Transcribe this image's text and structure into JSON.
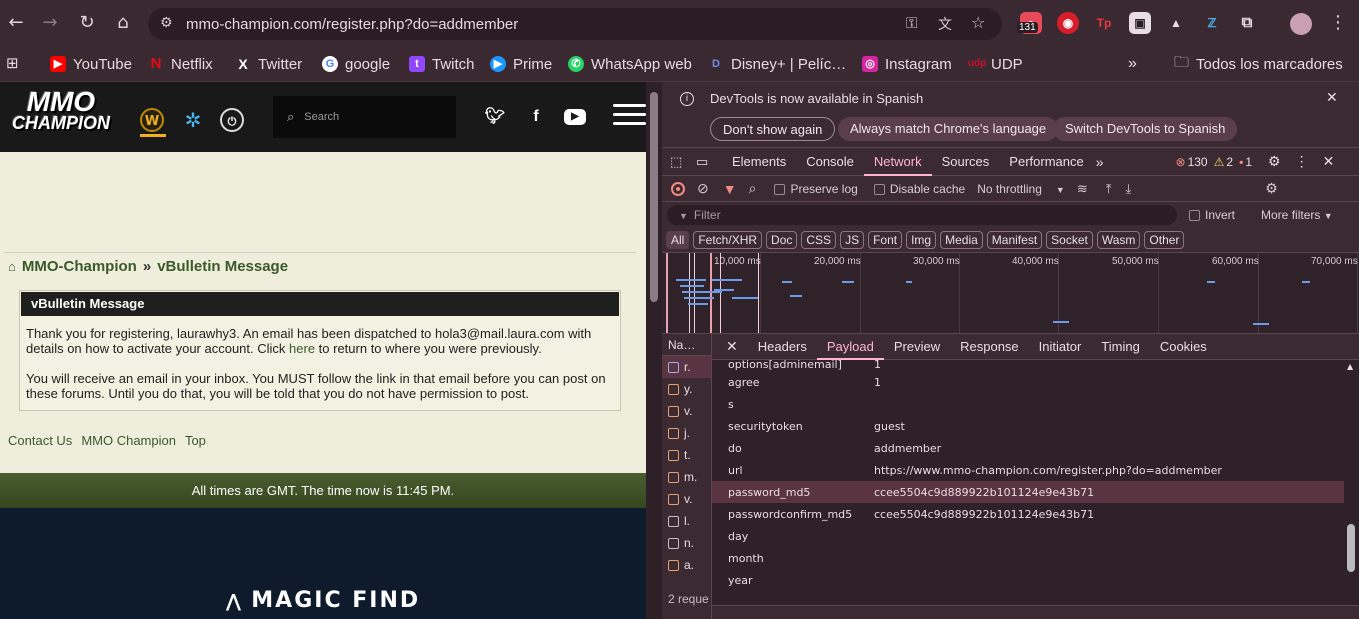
{
  "browser": {
    "url": "mmo-champion.com/register.php?do=addmember",
    "extensions": {
      "badge_count": "131"
    },
    "bookmarks": [
      {
        "label": "YouTube",
        "color": "#ff0000",
        "glyph": "▶"
      },
      {
        "label": "Netflix",
        "color": "#e50914",
        "glyph": "N"
      },
      {
        "label": "Twitter",
        "color": "#000000",
        "glyph": "X"
      },
      {
        "label": "google",
        "color": "#4285f4",
        "glyph": "G"
      },
      {
        "label": "Twitch",
        "color": "#9146ff",
        "glyph": "t"
      },
      {
        "label": "Prime",
        "color": "#1a98ff",
        "glyph": "▶"
      },
      {
        "label": "WhatsApp web",
        "color": "#25d366",
        "glyph": "✆"
      },
      {
        "label": "Disney+ | Pelíc…",
        "color": "#113ccf",
        "glyph": "D"
      },
      {
        "label": "Instagram",
        "color": "#d6249f",
        "glyph": "◎"
      },
      {
        "label": "UDP",
        "color": "#c8102e",
        "glyph": "u"
      }
    ],
    "all_bookmarks": "Todos los marcadores"
  },
  "site": {
    "logo_line1": "MMO",
    "logo_line2": "CHAMPION",
    "search_placeholder": "Search",
    "breadcrumb": {
      "home": "MMO-Champion",
      "sep": "»",
      "current": "vBulletin Message"
    },
    "message": {
      "title": "vBulletin Message",
      "p1_before": "Thank you for registering, laurawhy3. An email has been dispatched to hola3@mail.laura.com with details on how to activate your account. Click ",
      "p1_link": "here",
      "p1_after": " to return to where you were previously.",
      "p2": "You will receive an email in your inbox. You MUST follow the link in that email before you can post on these forums. Until you do that, you will be told that you do not have permission to post."
    },
    "footer_links": [
      "Contact Us",
      "MMO Champion",
      "Top"
    ],
    "time_text": "All times are GMT. The time now is 11:45 PM.",
    "ad_brand": "MAGIC FIND"
  },
  "devtools": {
    "infobar": {
      "text": "DevTools is now available in Spanish",
      "btn_dont_show": "Don't show again",
      "btn_match": "Always match Chrome's language",
      "btn_switch": "Switch DevTools to Spanish"
    },
    "tabs": [
      "Elements",
      "Console",
      "Network",
      "Sources",
      "Performance"
    ],
    "active_tab": "Network",
    "counts": {
      "errors": "130",
      "warnings": "2",
      "issues": "1"
    },
    "toolbar": {
      "preserve_log": "Preserve log",
      "disable_cache": "Disable cache",
      "throttling": "No throttling"
    },
    "filter": {
      "placeholder": "Filter",
      "invert": "Invert",
      "more_filters": "More filters"
    },
    "types": [
      "All",
      "Fetch/XHR",
      "Doc",
      "CSS",
      "JS",
      "Font",
      "Img",
      "Media",
      "Manifest",
      "Socket",
      "Wasm",
      "Other"
    ],
    "timeline_ticks": [
      "10,000 ms",
      "20,000 ms",
      "30,000 ms",
      "40,000 ms",
      "50,000 ms",
      "60,000 ms",
      "70,000 ms"
    ],
    "request_list": {
      "header": "Na…",
      "rows": [
        "r.",
        "y.",
        "v.",
        "j.",
        "t.",
        "m.",
        "v.",
        "l.",
        "n.",
        "a."
      ],
      "footer": "2 reque"
    },
    "detail_tabs": [
      "Headers",
      "Payload",
      "Preview",
      "Response",
      "Initiator",
      "Timing",
      "Cookies"
    ],
    "active_detail_tab": "Payload",
    "payload": [
      {
        "key": "options[adminemail]",
        "value": "1"
      },
      {
        "key": "agree",
        "value": "1"
      },
      {
        "key": "s",
        "value": ""
      },
      {
        "key": "securitytoken",
        "value": "guest"
      },
      {
        "key": "do",
        "value": "addmember"
      },
      {
        "key": "url",
        "value": "https://www.mmo-champion.com/register.php?do=addmember"
      },
      {
        "key": "password_md5",
        "value": "ccee5504c9d889922b101124e9e43b71"
      },
      {
        "key": "passwordconfirm_md5",
        "value": "ccee5504c9d889922b101124e9e43b71"
      },
      {
        "key": "day",
        "value": ""
      },
      {
        "key": "month",
        "value": ""
      },
      {
        "key": "year",
        "value": ""
      }
    ],
    "selected_payload_index": 6
  }
}
